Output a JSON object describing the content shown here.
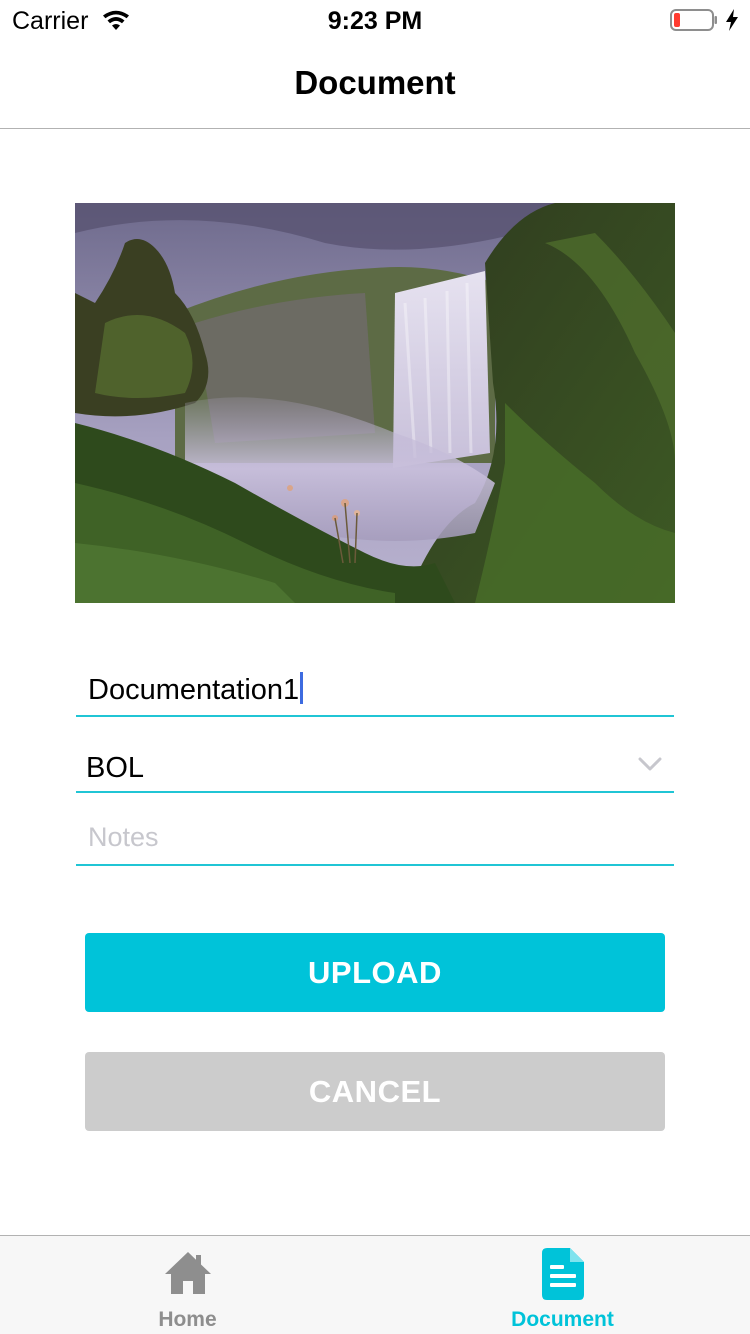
{
  "status_bar": {
    "carrier": "Carrier",
    "time": "9:23 PM",
    "icons": [
      "wifi-icon",
      "battery-low-icon",
      "charging-bolt-icon"
    ],
    "battery_color": "#ff3b30"
  },
  "nav": {
    "title": "Document"
  },
  "photo": {
    "subject": "waterfall-photo"
  },
  "form": {
    "name_value": "Documentation1",
    "type_value": "BOL",
    "type_icon": "chevron-down-icon",
    "notes_placeholder": "Notes",
    "underline_color": "#20c5d5"
  },
  "buttons": {
    "upload_label": "UPLOAD",
    "upload_color": "#00c3d9",
    "cancel_label": "CANCEL",
    "cancel_color": "#cccccc"
  },
  "tab_bar": {
    "tabs": [
      {
        "label": "Home",
        "icon": "home-icon",
        "active": false
      },
      {
        "label": "Document",
        "icon": "document-icon",
        "active": true
      }
    ],
    "active_color": "#00c3d9",
    "inactive_color": "#8e8e8e"
  }
}
